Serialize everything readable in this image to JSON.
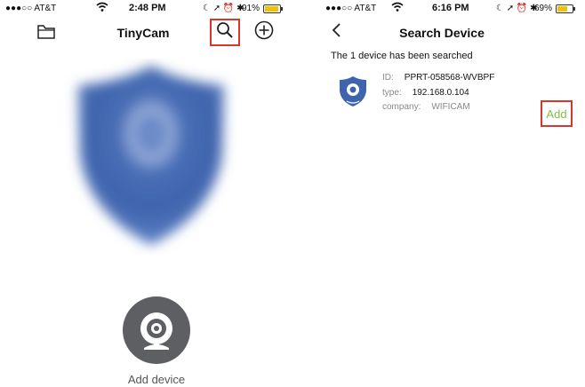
{
  "left": {
    "status": {
      "carrier": "●●●○○ AT&T",
      "time": "2:48 PM",
      "indicators": "☾ ➚ ⏰ ✱",
      "battery": "91%",
      "battery_level": 0.91
    },
    "title": "TinyCam",
    "add_device_label": "Add device",
    "icons": {
      "folder": "folder-icon",
      "search": "search-icon",
      "add": "add-circle-icon",
      "shield": "shield-icon",
      "camera": "camera-icon"
    }
  },
  "right": {
    "status": {
      "carrier": "●●●○○ AT&T",
      "time": "6:16 PM",
      "indicators": "☾ ➚ ⏰ ✱",
      "battery": "69%",
      "battery_level": 0.69
    },
    "title": "Search Device",
    "message": "The 1 device has been searched",
    "device": {
      "id_label": "ID:",
      "id_value": "PPRT-058568-WVBPF",
      "type_label": "type:",
      "type_value": "192.168.0.104",
      "company_label": "company:",
      "company_value": "WIFICAM"
    },
    "add_label": "Add",
    "colors": {
      "add_text": "#7dc23f",
      "highlight": "#d9372b",
      "shield_blue": "#3f64ad"
    }
  }
}
